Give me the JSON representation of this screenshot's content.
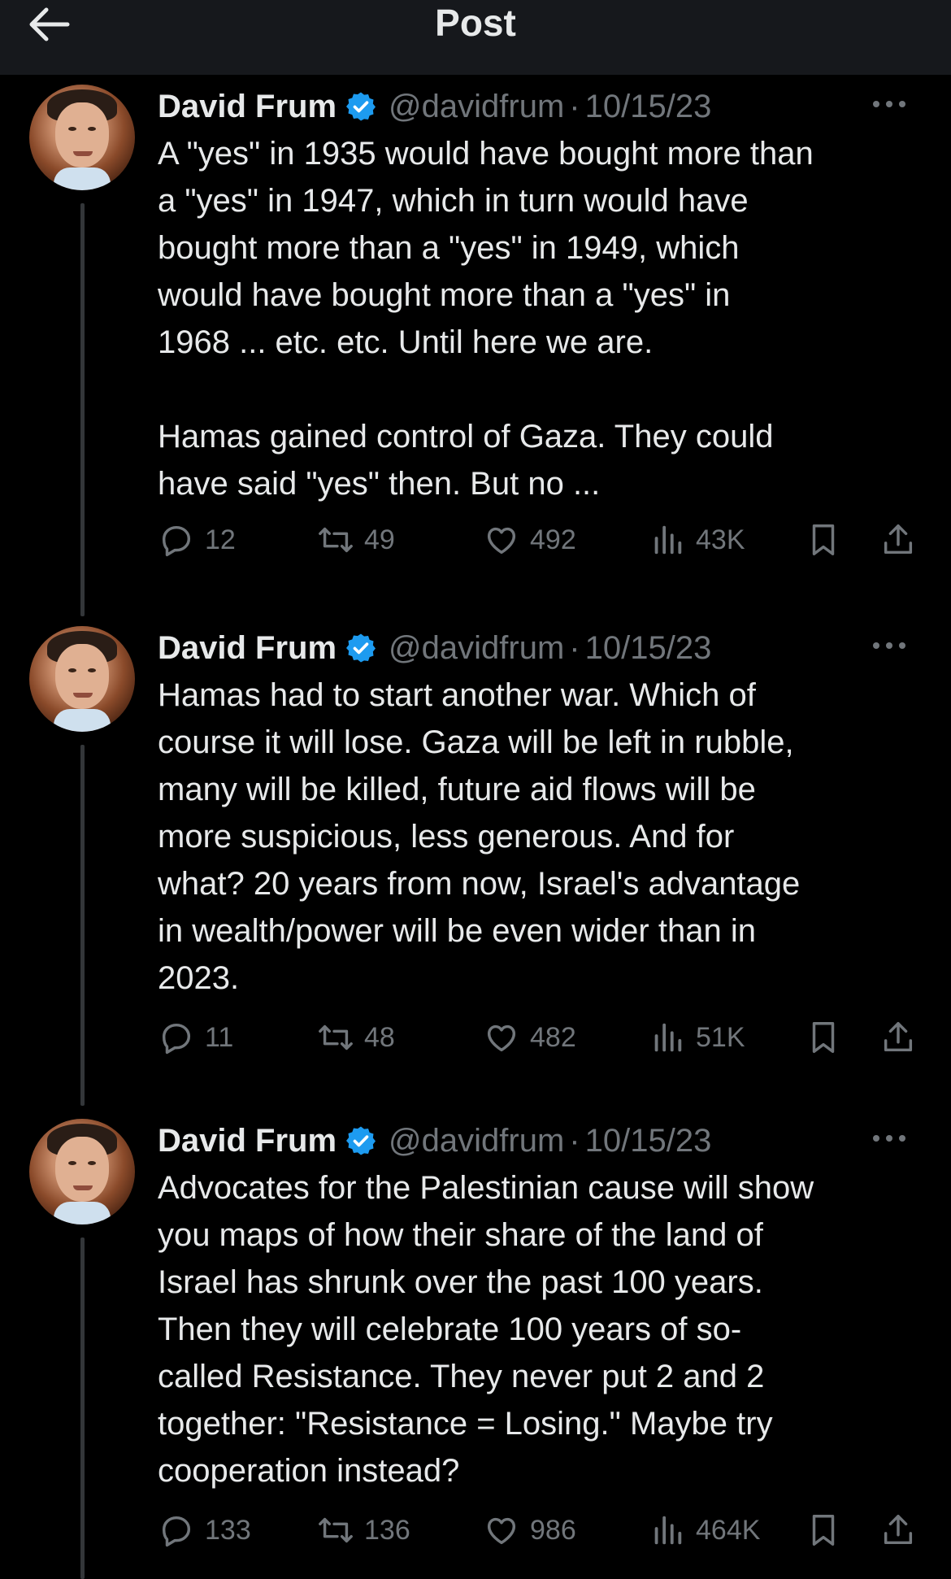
{
  "header": {
    "title": "Post",
    "back_icon": "arrow-left-icon"
  },
  "colors": {
    "background": "#000000",
    "header_bg": "#16181c",
    "text": "#e7e9ea",
    "muted": "#71767b",
    "verified": "#1d9bf0",
    "thread_line": "#333639"
  },
  "tweets": [
    {
      "name": "David Frum",
      "handle": "@davidfrum",
      "separator": "·",
      "date": "10/15/23",
      "text": "A \"yes\" in 1935 would have bought more than\na \"yes\" in 1947, which in turn would have\nbought more than a \"yes\" in 1949, which\nwould have bought more than a \"yes\" in\n1968 ... etc. etc. Until here we are.\n\nHamas gained control of Gaza. They could\nhave said \"yes\" then. But no ...",
      "replies": "12",
      "reposts": "49",
      "likes": "492",
      "views": "43K"
    },
    {
      "name": "David Frum",
      "handle": "@davidfrum",
      "separator": "·",
      "date": "10/15/23",
      "text": "Hamas had to start another war. Which of\ncourse it will lose. Gaza will be left in rubble,\nmany will be killed, future aid flows will be\nmore suspicious, less generous. And for\nwhat? 20 years from now, Israel's advantage\nin wealth/power will be even wider than in\n2023.",
      "replies": "11",
      "reposts": "48",
      "likes": "482",
      "views": "51K"
    },
    {
      "name": "David Frum",
      "handle": "@davidfrum",
      "separator": "·",
      "date": "10/15/23",
      "text": "Advocates for the Palestinian cause will show\nyou maps of how their share of the land of\nIsrael has shrunk over the past 100 years.\nThen they will celebrate 100 years of so-\ncalled Resistance. They never put 2 and 2\ntogether: \"Resistance = Losing.\" Maybe try\ncooperation instead?",
      "replies": "133",
      "reposts": "136",
      "likes": "986",
      "views": "464K"
    }
  ]
}
